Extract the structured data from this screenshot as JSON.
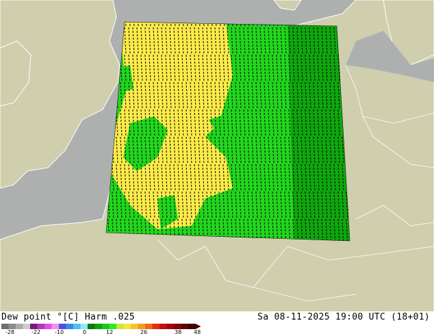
{
  "title": "Dew point °[C]  Harm .025",
  "valid_time": "Sa 08-11-2025 19:00 UTC (18+01)",
  "colors": {
    "land": "#cfcfae",
    "sea": "#aeb0b0",
    "domain_yellow": "#fbeb4a",
    "domain_green_bright": "#22d61e",
    "domain_green_dark": "#0fa60e",
    "coastline": "#ffffff",
    "contour": "#000000"
  },
  "legend": {
    "ticks": [
      "-28",
      "-22",
      "-10",
      "0",
      "12",
      "26",
      "38",
      "48"
    ],
    "swatches": [
      "#6f6f6f",
      "#8c8c8c",
      "#acacac",
      "#cbcbcb",
      "#7a1a7a",
      "#b03ab0",
      "#e052e0",
      "#f090f0",
      "#5050e0",
      "#3a8ae8",
      "#50c0f0",
      "#90e8f8",
      "#0a7a0a",
      "#0fa60e",
      "#1dc61a",
      "#2ee82a",
      "#c8e83a",
      "#f0e840",
      "#f8c030",
      "#f89a20",
      "#f06a10",
      "#e03010",
      "#c01010",
      "#a00808",
      "#800606",
      "#600404",
      "#400202"
    ]
  }
}
